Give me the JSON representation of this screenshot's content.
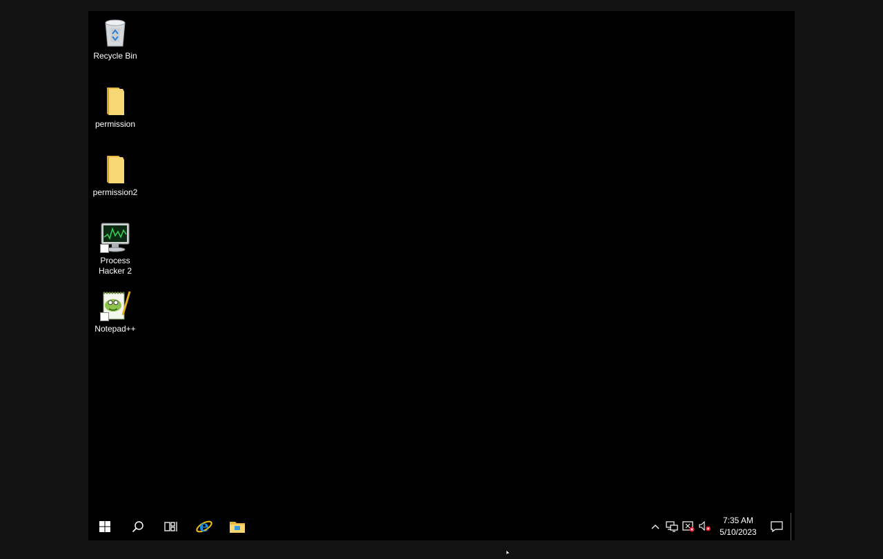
{
  "desktop": {
    "icons": [
      {
        "label": "Recycle Bin",
        "icon": "recycle-bin-icon"
      },
      {
        "label": "permission",
        "icon": "folder-icon"
      },
      {
        "label": "permission2",
        "icon": "folder-icon"
      },
      {
        "label": "Process Hacker 2",
        "icon": "process-hacker-icon"
      },
      {
        "label": "Notepad++",
        "icon": "notepadpp-icon"
      }
    ]
  },
  "taskbar": {
    "start": "windows-start-icon",
    "search": "search-icon",
    "task_view": "task-view-icon",
    "pinned": [
      "internet-explorer-icon",
      "file-explorer-icon"
    ],
    "tray": [
      "chevron-up-icon",
      "network-icon",
      "security-alert-icon",
      "volume-muted-icon"
    ],
    "clock": {
      "time": "7:35 AM",
      "date": "5/10/2023"
    },
    "notification": "action-center-icon"
  },
  "colors": {
    "desktop_bg": "#000000",
    "outer_bg": "#121212",
    "folder_yellow": "#f8d775",
    "ie_blue": "#1e8bd9",
    "alert_red": "#e81123"
  }
}
